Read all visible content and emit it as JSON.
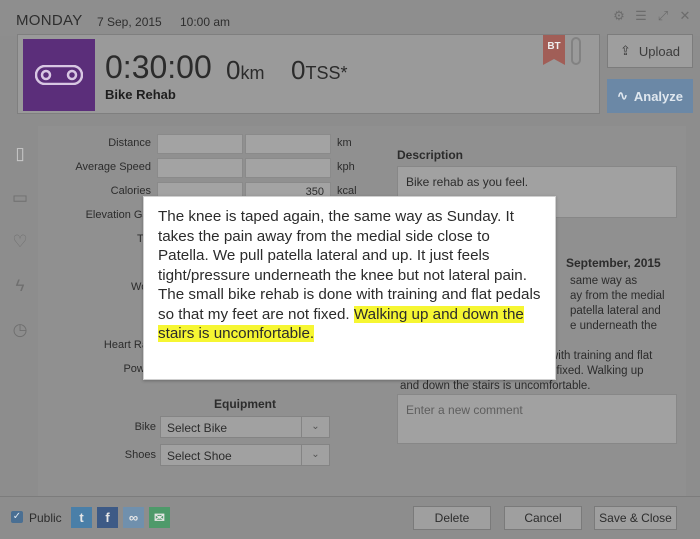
{
  "topbar": {
    "day": "MONDAY",
    "date": "7 Sep, 2015",
    "time": "10:00 am"
  },
  "window_icons": [
    "gear-icon",
    "menu-icon",
    "expand-icon",
    "close-icon"
  ],
  "workout": {
    "duration": "0:30:00",
    "distance_value": "0",
    "distance_unit": "km",
    "tss_value": "0",
    "tss_unit": "TSS*",
    "title": "Bike Rehab",
    "flag": "BT"
  },
  "buttons": {
    "upload": "Upload",
    "analyze": "Analyze",
    "delete": "Delete",
    "cancel": "Cancel",
    "save_close": "Save & Close"
  },
  "form": {
    "rows": [
      {
        "label": "Distance",
        "planned": "",
        "completed": "",
        "unit": "km"
      },
      {
        "label": "Average Speed",
        "planned": "",
        "completed": "",
        "unit": "kph"
      },
      {
        "label": "Calories",
        "planned": "",
        "completed": "350",
        "unit": "kcal"
      },
      {
        "label": "Elevation Gai",
        "planned": "",
        "completed": "",
        "unit": ""
      },
      {
        "label": "TS",
        "planned": "",
        "completed": "",
        "unit": ""
      },
      {
        "label": "I",
        "planned": "",
        "completed": "",
        "unit": ""
      },
      {
        "label": "Wor",
        "planned": "",
        "completed": "",
        "unit": ""
      },
      {
        "label": "Heart Rat",
        "planned": "",
        "completed": "",
        "unit": ""
      },
      {
        "label": "Powe",
        "planned": "",
        "completed": "",
        "unit": ""
      }
    ],
    "equipment_title": "Equipment",
    "bike_label": "Bike",
    "bike_value": "Select Bike",
    "shoes_label": "Shoes",
    "shoes_value": "Select Shoe"
  },
  "description": {
    "title": "Description",
    "text": "Bike rehab as you feel."
  },
  "comment": {
    "date_fragment": "September, 2015",
    "lines": [
      "same way as",
      "ay from the medial",
      "patella lateral and",
      "e underneath the",
      "",
      "with training and flat",
      "t fixed. Walking up",
      "and down the stairs is uncomfortable."
    ],
    "placeholder": "Enter a new comment"
  },
  "popup": {
    "text": "The knee is taped again, the same way as Sunday. It takes the pain away from the medial side close to Patella. We pull patella lateral and up. It just feels tight/pressure underneath the knee but not lateral pain.",
    "text2": "The small bike rehab is done with training and flat pedals so that my feet are not fixed. ",
    "highlight": "Walking up and down the stairs is uncomfortable.",
    "highlight_color": "#f6f632"
  },
  "footer": {
    "public_label": "Public",
    "public_checked": true,
    "share_icons": [
      "twitter-icon",
      "facebook-icon",
      "link-icon",
      "email-icon"
    ]
  },
  "colors": {
    "sport_badge": "#5b2e7a",
    "analyze": "#6b88a6",
    "flag": "#a15e57"
  }
}
